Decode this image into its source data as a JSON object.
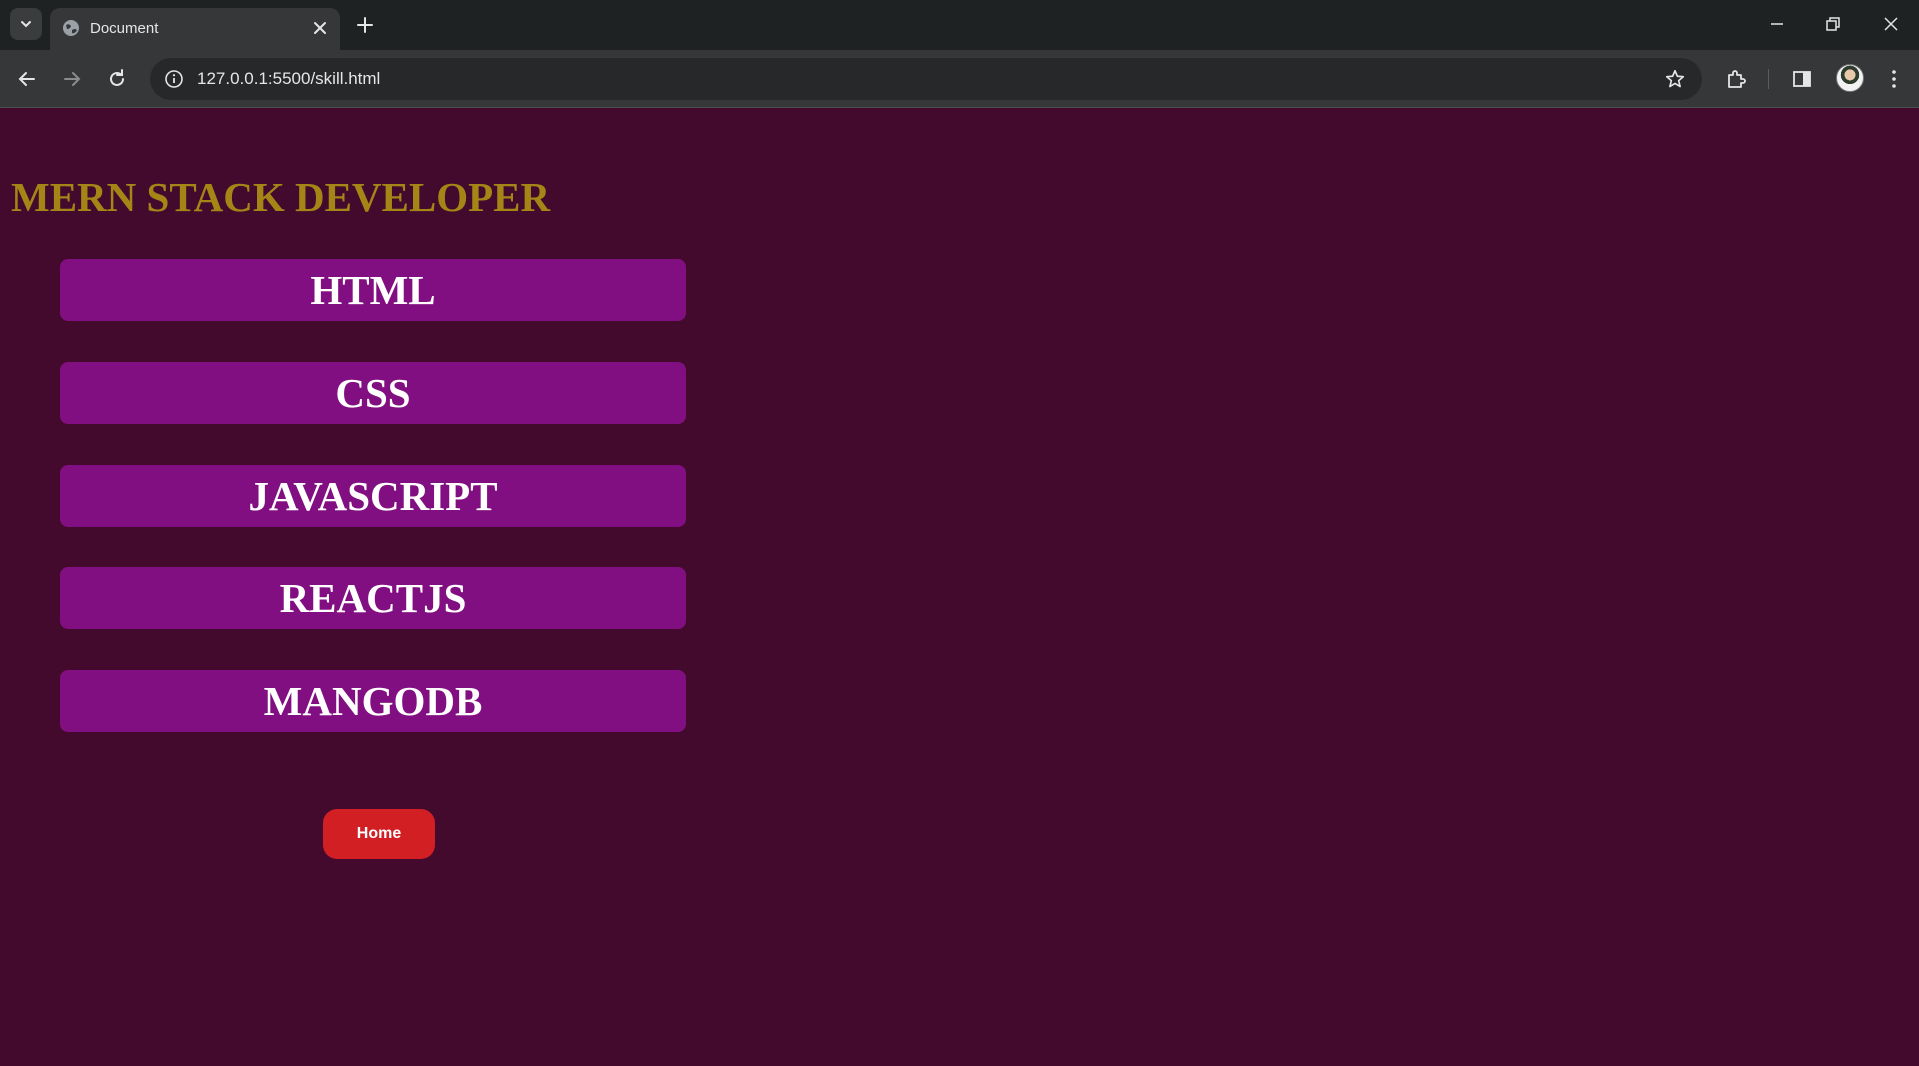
{
  "browser": {
    "tab_title": "Document",
    "url": "127.0.0.1:5500/skill.html",
    "colors": {
      "tabbar": "#1f2223",
      "toolbar": "#353739",
      "omnibox": "#262829"
    }
  },
  "page": {
    "title": "MERN STACK DEVELOPER",
    "skills": [
      "HTML",
      "CSS",
      "JAVASCRIPT",
      "REACTJS",
      "MANGODB"
    ],
    "home_label": "Home",
    "colors": {
      "background": "#430a2d",
      "title": "#a68517",
      "skill_button": "#820f81",
      "home_button": "#d11f24"
    }
  }
}
